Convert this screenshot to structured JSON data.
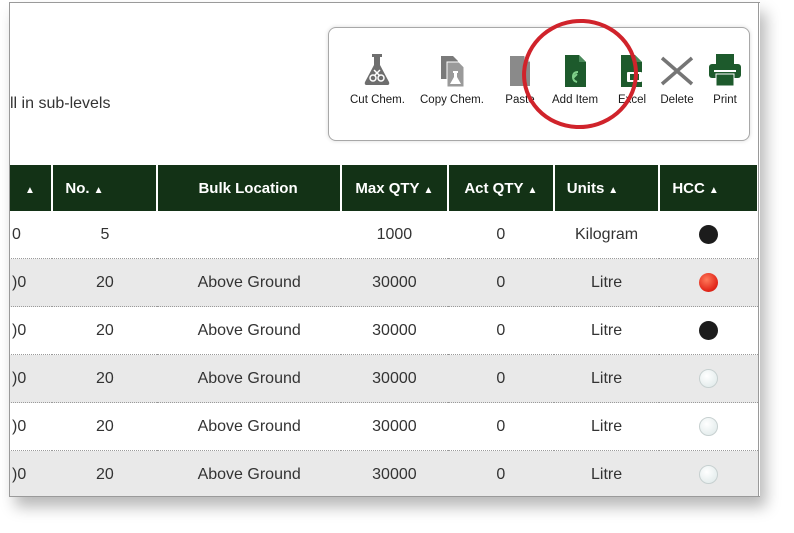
{
  "page": {
    "sublevels_text": "ll in sub-levels"
  },
  "toolbar": {
    "items": [
      {
        "label": "Cut Chem.",
        "icon": "flask-scissors-icon"
      },
      {
        "label": "Copy Chem.",
        "icon": "copy-flask-icon"
      },
      {
        "label": "Paste",
        "icon": "paste-icon"
      },
      {
        "label": "Add Item",
        "icon": "add-document-icon"
      },
      {
        "label": "Excel",
        "icon": "excel-icon"
      },
      {
        "label": "Delete",
        "icon": "delete-x-icon"
      },
      {
        "label": "Print",
        "icon": "printer-icon"
      }
    ],
    "highlight_color": "#d0232b",
    "icon_color": "#1d5a2c"
  },
  "table": {
    "columns": [
      {
        "label": "",
        "sort": "▲"
      },
      {
        "label": "No.",
        "sort": "▲"
      },
      {
        "label": "Bulk Location",
        "sort": ""
      },
      {
        "label": "Max QTY",
        "sort": "▲"
      },
      {
        "label": "Act QTY",
        "sort": "▲"
      },
      {
        "label": "Units",
        "sort": "▲"
      },
      {
        "label": "HCC",
        "sort": "▲"
      }
    ],
    "rows": [
      {
        "first": "0",
        "no": "5",
        "location": "",
        "max": "1000",
        "act": "0",
        "units": "Kilogram",
        "hcc": "black"
      },
      {
        "first": ")0",
        "no": "20",
        "location": "Above Ground",
        "max": "30000",
        "act": "0",
        "units": "Litre",
        "hcc": "red"
      },
      {
        "first": ")0",
        "no": "20",
        "location": "Above Ground",
        "max": "30000",
        "act": "0",
        "units": "Litre",
        "hcc": "black"
      },
      {
        "first": ")0",
        "no": "20",
        "location": "Above Ground",
        "max": "30000",
        "act": "0",
        "units": "Litre",
        "hcc": "none"
      },
      {
        "first": ")0",
        "no": "20",
        "location": "Above Ground",
        "max": "30000",
        "act": "0",
        "units": "Litre",
        "hcc": "none"
      },
      {
        "first": ")0",
        "no": "20",
        "location": "Above Ground",
        "max": "30000",
        "act": "0",
        "units": "Litre",
        "hcc": "none"
      }
    ],
    "header_color": "#133216",
    "alt_row_color": "#e9e9e9"
  }
}
